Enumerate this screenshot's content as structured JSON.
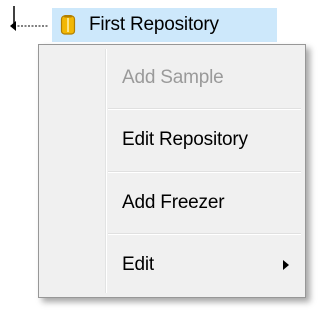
{
  "tree": {
    "node": {
      "label": "First Repository",
      "icon": "repository-icon",
      "selected": true,
      "highlight_color": "#cde8fb",
      "icon_color": "#f2b705"
    }
  },
  "context_menu": {
    "items": [
      {
        "label": "Add Sample",
        "enabled": false,
        "has_submenu": false
      },
      {
        "label": "Edit Repository",
        "enabled": true,
        "has_submenu": false
      },
      {
        "label": "Add Freezer",
        "enabled": true,
        "has_submenu": false
      },
      {
        "label": "Edit",
        "enabled": true,
        "has_submenu": true,
        "submenu_icon": "chevron-right-icon"
      }
    ],
    "colors": {
      "background": "#f0f0f0",
      "border": "#979797",
      "disabled_text": "#9a9a9a"
    }
  }
}
